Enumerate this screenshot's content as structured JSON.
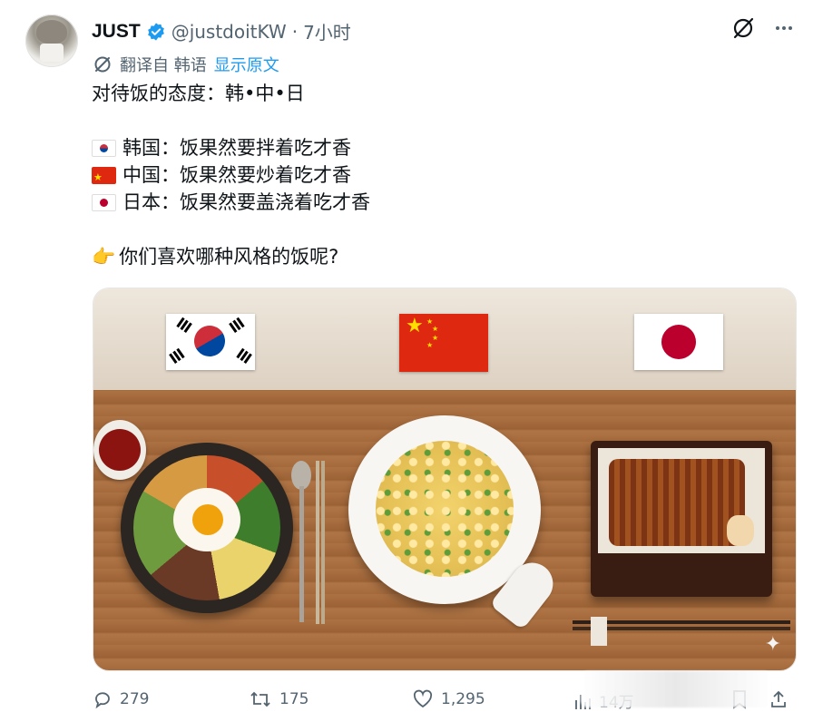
{
  "author": {
    "name": "JUST",
    "handle": "@justdoitKW",
    "separator": "·",
    "time": "7小时"
  },
  "translation": {
    "text": "翻译自 韩语",
    "link": "显示原文"
  },
  "tweet": {
    "line1": "对待饭的态度：韩•中•日",
    "korea": "韩国：饭果然要拌着吃才香",
    "china": "中国：饭果然要炒着吃才香",
    "japan": "日本：饭果然要盖浇着吃才香",
    "question": "你们喜欢哪种风格的饭呢?"
  },
  "icons": {
    "verified": "verified-badge-icon",
    "grok": "grok-icon",
    "more": "more-icon",
    "translate": "translate-icon",
    "pointing": "pointing-hand-icon"
  },
  "stats": {
    "replies": "279",
    "retweets": "175",
    "likes": "1,295",
    "views": "14万"
  },
  "colors": {
    "accent": "#1d9bf0",
    "secondary_text": "#536471",
    "primary_text": "#0f1419"
  }
}
